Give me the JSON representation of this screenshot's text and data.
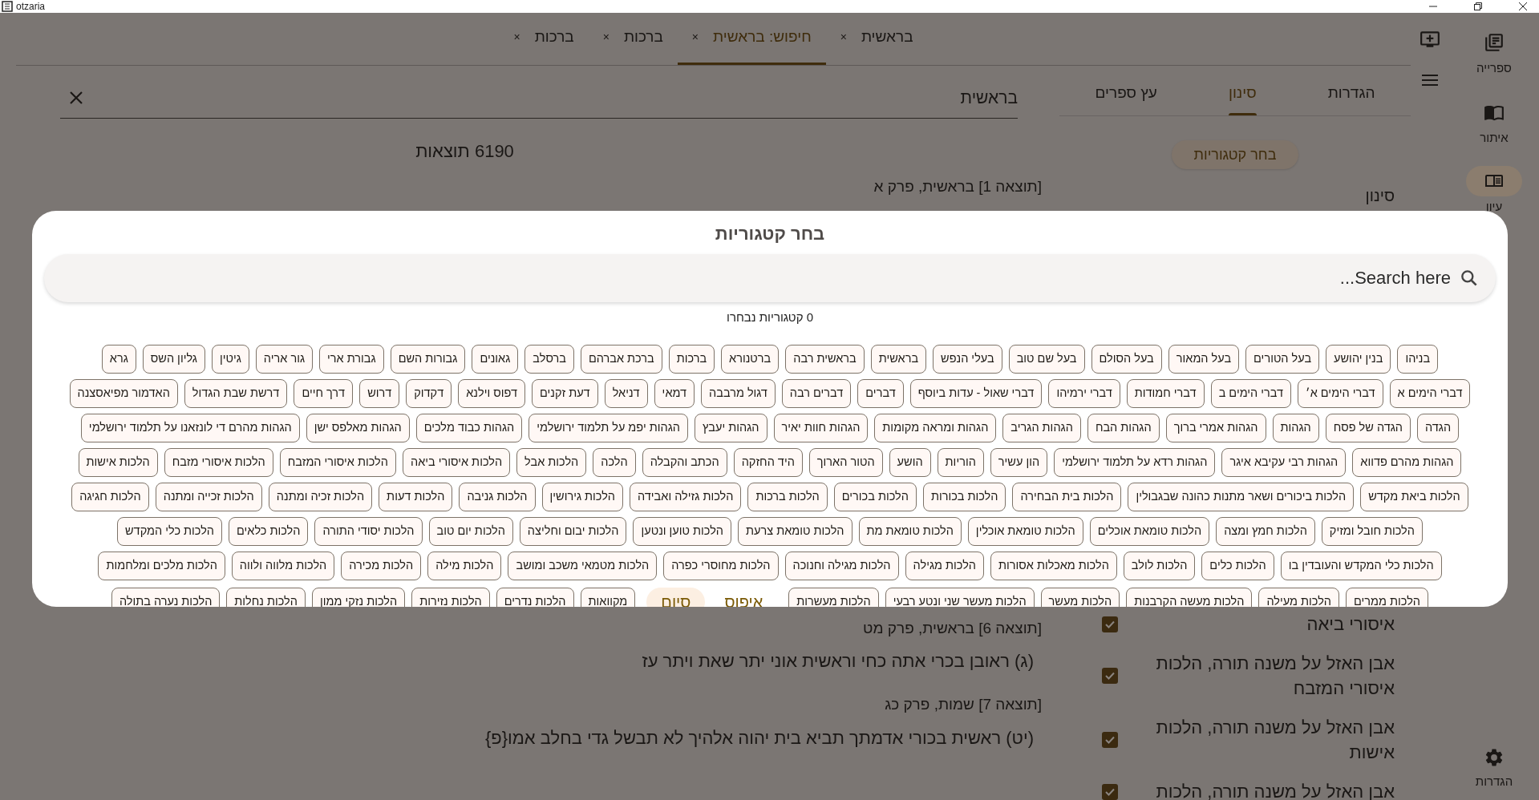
{
  "window": {
    "title": "otzaria"
  },
  "nav_rail": {
    "items": [
      {
        "label": "ספרייה",
        "selected": false
      },
      {
        "label": "איתור",
        "selected": false
      },
      {
        "label": "עיון",
        "selected": true
      }
    ],
    "bottom": {
      "label": "הגדרות"
    }
  },
  "tabs": [
    {
      "label": "בראשית",
      "close": "×",
      "selected": false
    },
    {
      "label": "חיפוש: בראשית",
      "close": "×",
      "selected": true
    },
    {
      "label": "ברכות",
      "close": "×",
      "selected": false
    },
    {
      "label": "ברכות",
      "close": "×",
      "selected": false
    }
  ],
  "search": {
    "value": "בראשית"
  },
  "filter_tabs": [
    {
      "label": "הגדרות",
      "selected": false
    },
    {
      "label": "סינון",
      "selected": true
    },
    {
      "label": "עץ ספרים",
      "selected": false
    }
  ],
  "choose_categories_button": "בחר קטגוריות",
  "filter_label": "סינון",
  "result_count": "6190 תוצאות",
  "results_top": [
    {
      "title": "[תוצאה 1] בראשית, פרק א"
    }
  ],
  "results_bottom": [
    {
      "title": "[תוצאה 6] בראשית, פרק מט",
      "text": "(ג) ראובן בכרי אתה כחי וראשית אוני יתר שאת ויתר עז"
    },
    {
      "title": "[תוצאה 7] שמות, פרק כג",
      "text": "(יט) ראשית בכורי אדמתך תביא בית יהוה אלהיך לא תבשל גדי בחלב אמו{פ}"
    }
  ],
  "filter_items": [
    {
      "label": "איסורי ביאה",
      "checked": true
    },
    {
      "label": "אבן האזל על משנה תורה, הלכות איסורי המזבח",
      "checked": true
    },
    {
      "label": "אבן האזל על משנה תורה, הלכות אישות",
      "checked": true
    },
    {
      "label": "אבן האזל על משנה תורה, הלכות",
      "checked": true
    }
  ],
  "dialog": {
    "title": "בחר קטגוריות",
    "search_placeholder": "Search here...",
    "selected_count": "0 קטגוריות נבחרו",
    "category_rows": [
      [
        {
          "label": "בניהו",
          "selected": false
        },
        {
          "label": "בנין יהושע",
          "selected": false
        },
        {
          "label": "בעל הטורים",
          "selected": false
        },
        {
          "label": "בעל המאור",
          "selected": false
        },
        {
          "label": "בעל הסולם",
          "selected": false
        },
        {
          "label": "בעל שם טוב",
          "selected": false
        },
        {
          "label": "בעלי הנפש",
          "selected": false
        },
        {
          "label": "בראשית",
          "selected": false
        },
        {
          "label": "בראשית רבה",
          "selected": false
        },
        {
          "label": "ברטנורא",
          "selected": false
        },
        {
          "label": "ברכות",
          "selected": false
        },
        {
          "label": "ברכת אברהם",
          "selected": false
        },
        {
          "label": "ברסלב",
          "selected": false
        },
        {
          "label": "גאונים",
          "selected": false
        },
        {
          "label": "גבורות השם",
          "selected": false
        },
        {
          "label": "גבורת ארי",
          "selected": false
        },
        {
          "label": "גור אריה",
          "selected": false
        },
        {
          "label": "גיטין",
          "selected": false
        },
        {
          "label": "גליון השס",
          "selected": false
        },
        {
          "label": "גרא",
          "selected": false
        }
      ],
      [
        {
          "label": "דברי הימים א",
          "selected": false
        },
        {
          "label": "דברי הימים א׳",
          "selected": false
        },
        {
          "label": "דברי הימים ב",
          "selected": false
        },
        {
          "label": "דברי חמודות",
          "selected": false
        },
        {
          "label": "דברי ירמיהו",
          "selected": false
        },
        {
          "label": "דברי שאול - עדות ביוסף",
          "selected": false
        },
        {
          "label": "דברים",
          "selected": false
        },
        {
          "label": "דברים רבה",
          "selected": false
        },
        {
          "label": "דגול מרבבה",
          "selected": false
        },
        {
          "label": "דמאי",
          "selected": false
        },
        {
          "label": "דניאל",
          "selected": false
        },
        {
          "label": "דעת זקנים",
          "selected": false
        },
        {
          "label": "דפוס וילנא",
          "selected": false
        },
        {
          "label": "דקדוק",
          "selected": false
        },
        {
          "label": "דרוש",
          "selected": false
        },
        {
          "label": "דרך חיים",
          "selected": false
        },
        {
          "label": "דרשת שבת הגדול",
          "selected": false
        },
        {
          "label": "האדמור מפיאסצנה",
          "selected": false
        }
      ],
      [
        {
          "label": "הגדה",
          "selected": false
        },
        {
          "label": "הגדה של פסח",
          "selected": false
        },
        {
          "label": "הגהות",
          "selected": false
        },
        {
          "label": "הגהות אמרי ברוך",
          "selected": false
        },
        {
          "label": "הגהות הבח",
          "selected": false
        },
        {
          "label": "הגהות הגריב",
          "selected": false
        },
        {
          "label": "הגהות ומראה מקומות",
          "selected": false
        },
        {
          "label": "הגהות חוות יאיר",
          "selected": false
        },
        {
          "label": "הגהות יעבץ",
          "selected": false
        },
        {
          "label": "הגהות יפמ על תלמוד ירושלמי",
          "selected": false
        },
        {
          "label": "הגהות כבוד מלכים",
          "selected": false
        },
        {
          "label": "הגהות מאלפס ישן",
          "selected": false
        },
        {
          "label": "הגהות מהרם די לונזאנו על תלמוד ירושלמי",
          "selected": false
        }
      ],
      [
        {
          "label": "הגהות מהרם פדווא",
          "selected": false
        },
        {
          "label": "הגהות רבי עקיבא איגר",
          "selected": false
        },
        {
          "label": "הגהות רדא על תלמוד ירושלמי",
          "selected": false
        },
        {
          "label": "הון עשיר",
          "selected": false
        },
        {
          "label": "הוריות",
          "selected": false
        },
        {
          "label": "הושע",
          "selected": false
        },
        {
          "label": "הטור הארוך",
          "selected": false
        },
        {
          "label": "היד החזקה",
          "selected": false
        },
        {
          "label": "הכתב והקבלה",
          "selected": false
        },
        {
          "label": "הלכה",
          "selected": false
        },
        {
          "label": "הלכות אבל",
          "selected": false
        },
        {
          "label": "הלכות איסורי ביאה",
          "selected": false
        },
        {
          "label": "הלכות איסורי המזבח",
          "selected": false
        },
        {
          "label": "הלכות איסורי מזבח",
          "selected": false
        },
        {
          "label": "הלכות אישות",
          "selected": false
        }
      ],
      [
        {
          "label": "הלכות ביאת מקדש",
          "selected": false
        },
        {
          "label": "הלכות ביכורים ושאר מתנות כהונה שבגבולין",
          "selected": false
        },
        {
          "label": "הלכות בית הבחירה",
          "selected": false
        },
        {
          "label": "הלכות בכורות",
          "selected": false
        },
        {
          "label": "הלכות בכורים",
          "selected": false
        },
        {
          "label": "הלכות ברכות",
          "selected": false
        },
        {
          "label": "הלכות גזילה ואבידה",
          "selected": false
        },
        {
          "label": "הלכות גירושין",
          "selected": false
        },
        {
          "label": "הלכות גניבה",
          "selected": false
        },
        {
          "label": "הלכות דעות",
          "selected": false
        },
        {
          "label": "הלכות זכיה ומתנה",
          "selected": false
        },
        {
          "label": "הלכות זכייה ומתנה",
          "selected": false
        },
        {
          "label": "הלכות חגיגה",
          "selected": false
        }
      ],
      [
        {
          "label": "הלכות חובל ומזיק",
          "selected": false
        },
        {
          "label": "הלכות חמץ ומצה",
          "selected": false
        },
        {
          "label": "הלכות טומאת אוכלים",
          "selected": false
        },
        {
          "label": "הלכות טומאת אוכלין",
          "selected": false
        },
        {
          "label": "הלכות טומאת מת",
          "selected": false
        },
        {
          "label": "הלכות טומאת צרעת",
          "selected": false
        },
        {
          "label": "הלכות טוען ונטען",
          "selected": false
        },
        {
          "label": "הלכות יבום וחליצה",
          "selected": false
        },
        {
          "label": "הלכות יום טוב",
          "selected": false
        },
        {
          "label": "הלכות יסודי התורה",
          "selected": false
        },
        {
          "label": "הלכות כלאים",
          "selected": false
        },
        {
          "label": "הלכות כלי המקדש",
          "selected": false
        }
      ],
      [
        {
          "label": "הלכות כלי המקדש והעובדין בו",
          "selected": false
        },
        {
          "label": "הלכות כלים",
          "selected": false
        },
        {
          "label": "הלכות לולב",
          "selected": false
        },
        {
          "label": "הלכות מאכלות אסורות",
          "selected": false
        },
        {
          "label": "הלכות מגילה",
          "selected": false
        },
        {
          "label": "הלכות מגילה וחנוכה",
          "selected": false
        },
        {
          "label": "הלכות מחוסרי כפרה",
          "selected": false
        },
        {
          "label": "הלכות מטמאי משכב ומושב",
          "selected": false
        },
        {
          "label": "הלכות מילה",
          "selected": false
        },
        {
          "label": "הלכות מכירה",
          "selected": false
        },
        {
          "label": "הלכות מלווה ולווה",
          "selected": false
        },
        {
          "label": "הלכות מלכים ומלחמות",
          "selected": false
        }
      ],
      [
        {
          "label": "הלכות ממרים",
          "selected": false
        },
        {
          "label": "הלכות מעילה",
          "selected": false
        },
        {
          "label": "הלכות מעשה הקרבנות",
          "selected": false
        },
        {
          "label": "הלכות מעשר",
          "selected": false
        },
        {
          "label": "הלכות מעשר שני ונטע רבעי",
          "selected": false
        },
        {
          "label": "הלכות מעשרות",
          "selected": false
        },
        {
          "label": "מקוואות",
          "selected": false
        },
        {
          "label": "הלכות נדרים",
          "selected": false
        },
        {
          "label": "הלכות נזירות",
          "selected": false
        },
        {
          "label": "הלכות נזקי ממון",
          "selected": false
        },
        {
          "label": "הלכות נחלות",
          "selected": false
        },
        {
          "label": "הלכות נערה בתולה",
          "selected": false
        }
      ]
    ],
    "buttons": [
      {
        "label": "איפוס",
        "selected": false
      },
      {
        "label": "סיום",
        "selected": true
      }
    ]
  }
}
